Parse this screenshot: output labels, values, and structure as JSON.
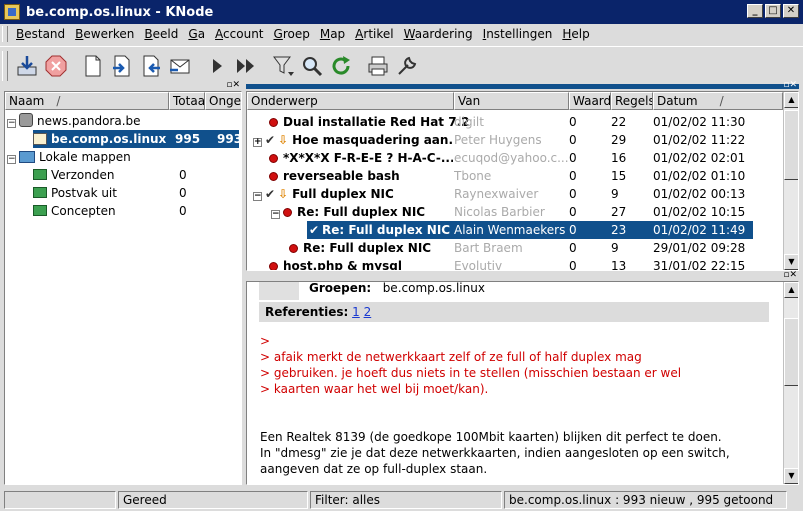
{
  "window": {
    "title": "be.comp.os.linux - KNode"
  },
  "menu": [
    "Bestand",
    "Bewerken",
    "Beeld",
    "Ga",
    "Account",
    "Groep",
    "Map",
    "Artikel",
    "Waardering",
    "Instellingen",
    "Help"
  ],
  "toolbar": {
    "icons": [
      "get-new-articles-icon",
      "stop-icon",
      "new-article-icon",
      "next-group-icon",
      "previous-group-icon",
      "post-followup-icon",
      "next-article-icon",
      "next-unread-thread-icon",
      "filter-icon",
      "search-icon",
      "refresh-icon",
      "print-icon",
      "settings-icon"
    ]
  },
  "folders": {
    "headers": {
      "name": "Naam",
      "total": "Totaal",
      "unread": "Ongel"
    },
    "server": "news.pandora.be",
    "group": {
      "name": "be.comp.os.linux",
      "total": "995",
      "unread": "993"
    },
    "local": "Lokale mappen",
    "subfolders": [
      {
        "name": "Verzonden",
        "total": "0"
      },
      {
        "name": "Postvak uit",
        "total": "0"
      },
      {
        "name": "Concepten",
        "total": "0"
      }
    ]
  },
  "articles": {
    "headers": {
      "subject": "Onderwerp",
      "from": "Van",
      "score": "Waard",
      "lines": "Regels",
      "date": "Datum"
    },
    "rows": [
      {
        "subject": "Dual installatie Red Hat 7.2",
        "from": "digilt",
        "score": "0",
        "lines": "22",
        "date": "01/02/02 11:30"
      },
      {
        "subject": "Hoe masquadering aan...",
        "from": "Peter Huygens",
        "score": "0",
        "lines": "29",
        "date": "01/02/02 11:22"
      },
      {
        "subject": "*X*X*X F-R-E-E ? H-A-C-...",
        "from": "ecuqod@yahoo.c...",
        "score": "0",
        "lines": "16",
        "date": "01/02/02 02:01"
      },
      {
        "subject": "reverseable bash",
        "from": "Tbone",
        "score": "0",
        "lines": "15",
        "date": "01/02/02 01:10"
      },
      {
        "subject": "Full duplex NIC",
        "from": "Raynexwaiver",
        "score": "0",
        "lines": "9",
        "date": "01/02/02 00:13"
      },
      {
        "subject": "Re: Full duplex NIC",
        "from": "Nicolas Barbier",
        "score": "0",
        "lines": "27",
        "date": "01/02/02 10:15"
      },
      {
        "subject": "Re: Full duplex NIC",
        "from": "Alain Wenmaekers",
        "score": "0",
        "lines": "23",
        "date": "01/02/02 11:49"
      },
      {
        "subject": "Re: Full duplex NIC",
        "from": "Bart Braem",
        "score": "0",
        "lines": "9",
        "date": "29/01/02 09:28"
      },
      {
        "subject": "host.php & mysql",
        "from": "Evolutiv",
        "score": "0",
        "lines": "13",
        "date": "31/01/02 22:15"
      }
    ]
  },
  "article": {
    "groups_label": "Groepen:",
    "groups_value": "be.comp.os.linux",
    "refs_label": "Referenties:",
    "refs": [
      "1",
      "2"
    ],
    "quoted": [
      ">",
      "> afaik merkt de netwerkkaart zelf of ze full of half duplex mag",
      "> gebruiken. je hoeft dus niets in te stellen (misschien bestaan er wel",
      "> kaarten waar het wel bij moet/kan)."
    ],
    "body": [
      "Een Realtek 8139 (de goedkope 100Mbit kaarten) blijken dit perfect te doen.",
      "In \"dmesg\" zie je dat deze netwerkkaarten, indien aangesloten op een switch,",
      "aangeven dat ze op full-duplex staan."
    ]
  },
  "status": {
    "ready": "Gereed",
    "filter": "Filter: alles",
    "group": "be.comp.os.linux : 993 nieuw , 995 getoond"
  }
}
